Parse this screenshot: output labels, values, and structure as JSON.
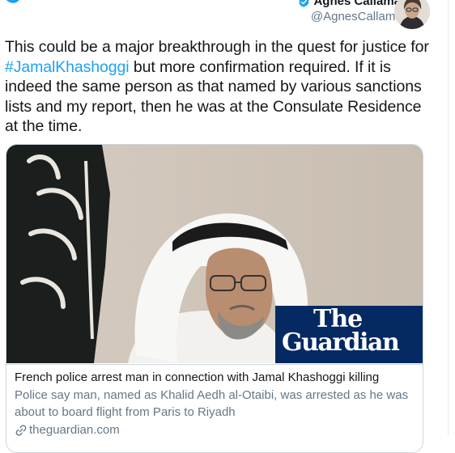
{
  "tweet": {
    "author_name": "Agnes Callamard",
    "author_handle": "@AgnesCallamard",
    "text_before": "This could be a major breakthrough in  the quest for justice for ",
    "hashtag": "#JamalKhashoggi",
    "text_after": " but more confirmation required. If it is indeed the same person as that named by various sanctions lists and my report, then he was at the Consulate Residence at the time."
  },
  "card": {
    "logo_line1": "The",
    "logo_line2": "Guardian",
    "title": "French police arrest man in connection with Jamal Khashoggi killing",
    "description": "Police say man, named as Khalid Aedh al-Otaibi, was arrested as he was about to board flight from Paris to Riyadh",
    "domain": "theguardian.com"
  },
  "icons": {
    "brand": "twitter-bird-icon",
    "verified": "verified-badge-icon",
    "link": "link-icon"
  },
  "colors": {
    "twitter_blue": "#1da1f2",
    "guardian_navy": "#052962",
    "secondary_text": "#657786",
    "border": "#ccd6dd"
  }
}
